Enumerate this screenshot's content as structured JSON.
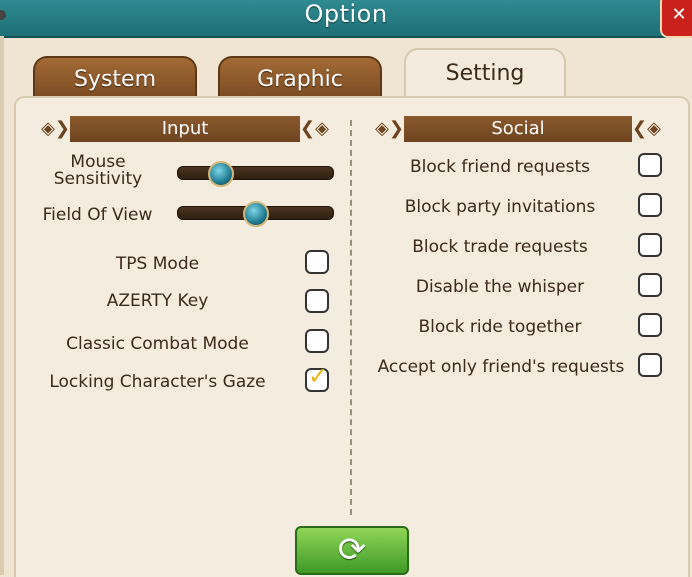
{
  "window": {
    "title": "Option"
  },
  "tabs": [
    {
      "label": "System",
      "active": false
    },
    {
      "label": "Graphic",
      "active": false
    },
    {
      "label": "Setting",
      "active": true
    }
  ],
  "input": {
    "header": "Input",
    "sliders": [
      {
        "label_line1": "Mouse",
        "label_line2": "Sensitivity",
        "value": 0.28
      },
      {
        "label": "Field Of View",
        "value": 0.5
      }
    ],
    "options": [
      {
        "label": "TPS Mode",
        "checked": false
      },
      {
        "label": "AZERTY Key",
        "checked": false
      },
      {
        "label": "Classic Combat Mode",
        "checked": false
      },
      {
        "label": "Locking Character's Gaze",
        "checked": true
      }
    ]
  },
  "social": {
    "header": "Social",
    "options": [
      {
        "label": "Block friend requests",
        "checked": false
      },
      {
        "label": "Block party invitations",
        "checked": false
      },
      {
        "label": "Block trade requests",
        "checked": false
      },
      {
        "label": "Disable the whisper",
        "checked": false
      },
      {
        "label": "Block ride together",
        "checked": false
      },
      {
        "label": "Accept only friend's requests",
        "checked": false
      }
    ]
  },
  "icons": {
    "close": "close-icon",
    "reset": "refresh-icon",
    "checkmark": "check-icon",
    "ornament": "double-chevron-ornament"
  },
  "colors": {
    "titlebar": "#2f8a91",
    "tab_inactive": "#8f5b2c",
    "header_band": "#7a4c24",
    "panel_bg": "#f4eddf",
    "reset_button": "#5fb83a",
    "close_button": "#c9221c"
  }
}
